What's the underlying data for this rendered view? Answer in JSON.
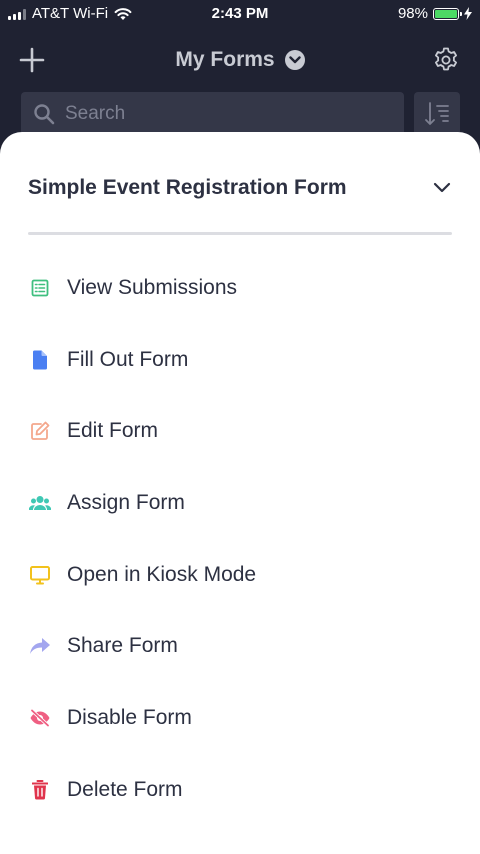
{
  "status_bar": {
    "carrier": "AT&T Wi-Fi",
    "time": "2:43 PM",
    "battery_percent": "98%",
    "battery_level": 0.98
  },
  "header": {
    "title": "My Forms"
  },
  "search": {
    "placeholder": "Search"
  },
  "sheet": {
    "title": "Simple Event Registration Form",
    "items": [
      {
        "label": "View Submissions",
        "icon": "list-icon",
        "color": "#3fbf7f"
      },
      {
        "label": "Fill Out Form",
        "icon": "document-icon",
        "color": "#4a7ff2"
      },
      {
        "label": "Edit Form",
        "icon": "edit-icon",
        "color": "#f4a78c"
      },
      {
        "label": "Assign Form",
        "icon": "users-icon",
        "color": "#3fc8b4"
      },
      {
        "label": "Open in Kiosk Mode",
        "icon": "monitor-icon",
        "color": "#f2c21c"
      },
      {
        "label": "Share Form",
        "icon": "share-arrow-icon",
        "color": "#a3a6ef"
      },
      {
        "label": "Disable Form",
        "icon": "eye-off-icon",
        "color": "#ef5f82"
      },
      {
        "label": "Delete Form",
        "icon": "trash-icon",
        "color": "#e0344c"
      }
    ]
  }
}
